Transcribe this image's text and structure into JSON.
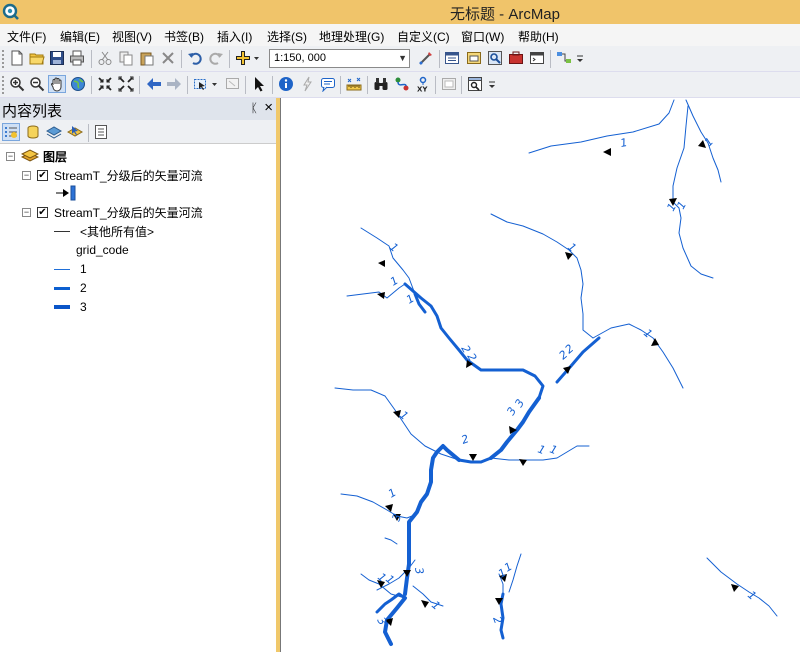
{
  "window": {
    "title": "无标题 - ArcMap",
    "app_icon": "arcmap-globe-icon"
  },
  "menu": [
    "文件(F)",
    "编辑(E)",
    "视图(V)",
    "书签(B)",
    "插入(I)",
    "选择(S)",
    "地理处理(G)",
    "自定义(C)",
    "窗口(W)",
    "帮助(H)"
  ],
  "toolbar": {
    "scale": "1:150, 000"
  },
  "toc": {
    "title": "内容列表",
    "pin_glyph": "ᛕ",
    "close_glyph": "×",
    "root_label": "图层",
    "layers": [
      {
        "name": "StreamT_分级后的矢量河流",
        "checked": true,
        "symbol": "arrow-and-blue-bar"
      },
      {
        "name": "StreamT_分级后的矢量河流",
        "checked": true,
        "other_values_label": "<其他所有值>",
        "field_label": "grid_code",
        "classes": [
          {
            "label": "1",
            "color": "#1f6fd8"
          },
          {
            "label": "2",
            "color": "#0c5fd0"
          },
          {
            "label": "3",
            "color": "#0a55c8"
          }
        ]
      }
    ]
  },
  "map": {
    "stream_color": "#1460d2",
    "background": "#ffffff",
    "grid_code_labels": [
      {
        "text": "1"
      },
      {
        "text": "1"
      },
      {
        "text": "1"
      },
      {
        "text": "1"
      },
      {
        "text": "1"
      },
      {
        "text": "1"
      },
      {
        "text": "1"
      },
      {
        "text": "1"
      },
      {
        "text": "1"
      },
      {
        "text": "1"
      },
      {
        "text": "1"
      },
      {
        "text": "1"
      },
      {
        "text": "1"
      },
      {
        "text": "1"
      },
      {
        "text": "1"
      },
      {
        "text": "1"
      },
      {
        "text": "1"
      },
      {
        "text": "1"
      },
      {
        "text": "1"
      },
      {
        "text": "2"
      },
      {
        "text": "2"
      },
      {
        "text": "2"
      },
      {
        "text": "2"
      },
      {
        "text": "2"
      },
      {
        "text": "3"
      },
      {
        "text": "3"
      },
      {
        "text": "3"
      },
      {
        "text": "3"
      },
      {
        "text": "3"
      },
      {
        "text": "2"
      }
    ]
  },
  "colors": {
    "title_bar": "#f0c46a",
    "toolbar_bg": "#eef0f3",
    "toc_header": "#dfe4ec",
    "stream": "#1460d2"
  }
}
